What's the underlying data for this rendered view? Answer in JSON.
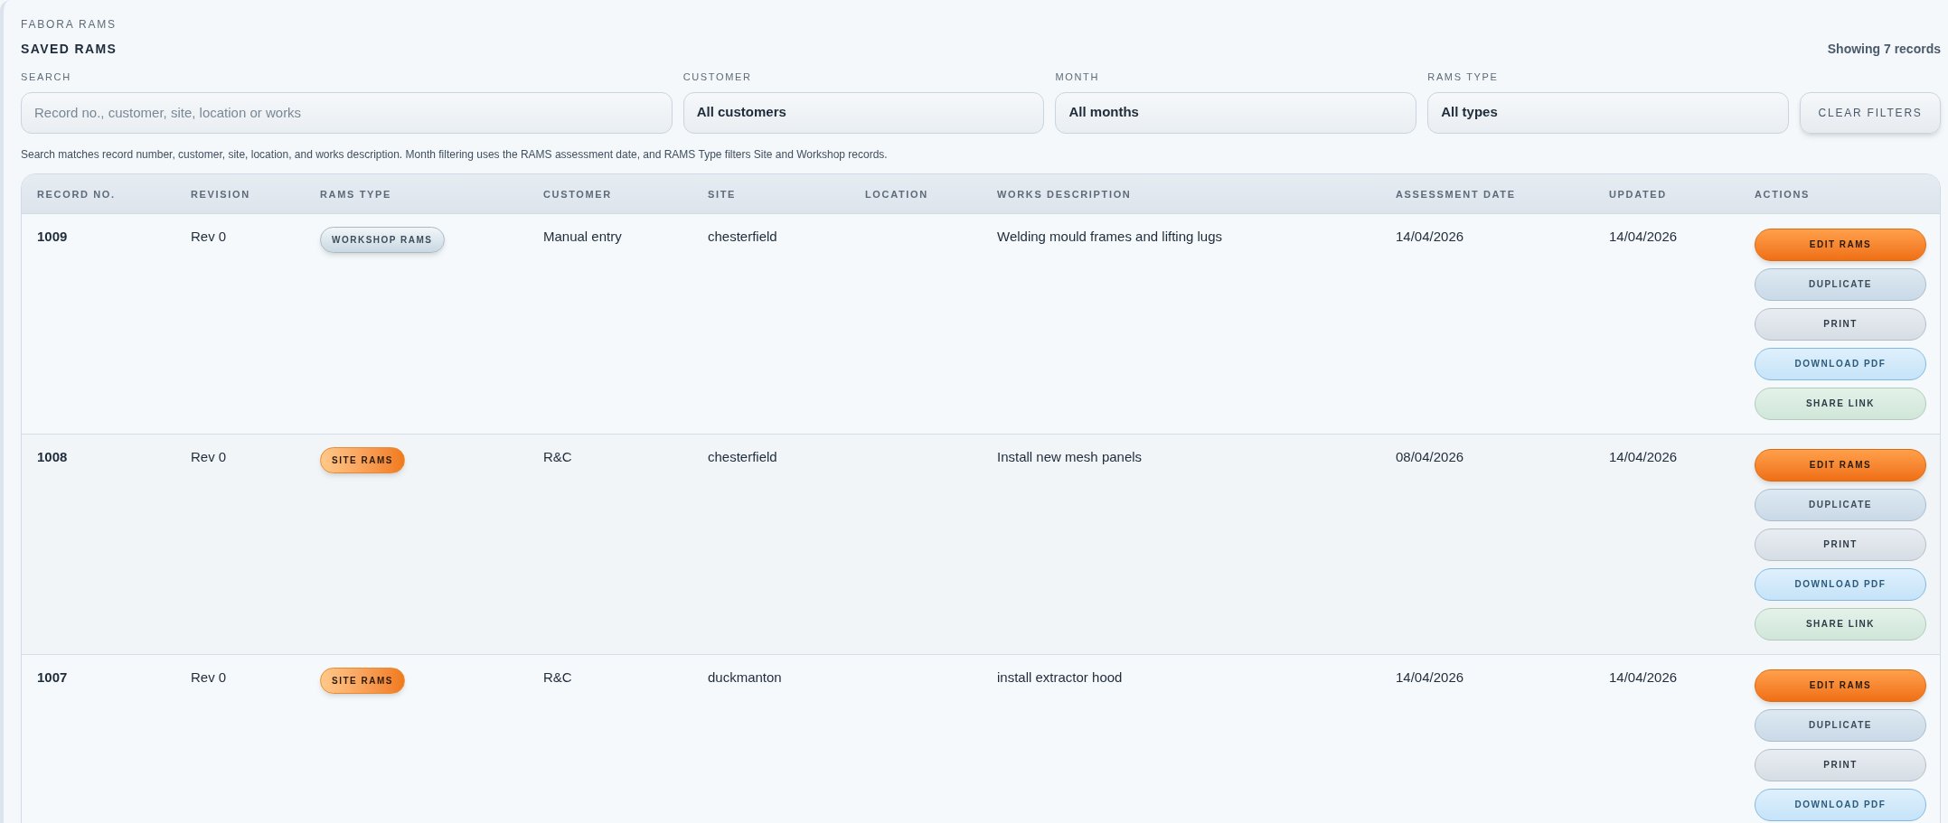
{
  "app": {
    "eyebrow": "FABORA RAMS",
    "title": "SAVED RAMS",
    "record_count": "Showing 7 records"
  },
  "filters": [
    {
      "kind": "search",
      "label": "SEARCH",
      "placeholder": "Record no., customer, site, location or works"
    },
    {
      "kind": "select",
      "label": "CUSTOMER",
      "value": "All customers"
    },
    {
      "kind": "select",
      "label": "MONTH",
      "value": "All months"
    },
    {
      "kind": "select",
      "label": "RAMS TYPE",
      "value": "All types"
    }
  ],
  "clear_button": "CLEAR FILTERS",
  "hint": "Search matches record number, customer, site, location, and works description. Month filtering uses the RAMS assessment date, and RAMS Type filters Site and Workshop records.",
  "table": {
    "columns": [
      "RECORD NO.",
      "REVISION",
      "RAMS TYPE",
      "CUSTOMER",
      "SITE",
      "LOCATION",
      "WORKS DESCRIPTION",
      "ASSESSMENT DATE",
      "UPDATED",
      "ACTIONS"
    ],
    "rows": [
      {
        "record": "1009",
        "revision": "Rev 0",
        "type": {
          "kind": "workshop",
          "label": "WORKSHOP RAMS"
        },
        "customer": "Manual entry",
        "site": "chesterfield",
        "works": "Welding mould frames and lifting lugs",
        "assessment_date": "14/04/2026",
        "updated": "14/04/2026",
        "actions": [
          {
            "kind": "edit",
            "label": "EDIT RAMS"
          },
          {
            "kind": "duplicate",
            "label": "DUPLICATE"
          },
          {
            "kind": "print",
            "label": "PRINT"
          },
          {
            "kind": "download",
            "label": "DOWNLOAD PDF"
          },
          {
            "kind": "share",
            "label": "SHARE LINK"
          }
        ]
      },
      {
        "record": "1008",
        "revision": "Rev 0",
        "type": {
          "kind": "site",
          "label": "SITE RAMS"
        },
        "customer": "R&C",
        "site": "chesterfield",
        "works": "Install new mesh panels",
        "assessment_date": "08/04/2026",
        "updated": "14/04/2026",
        "actions": [
          {
            "kind": "edit",
            "label": "EDIT RAMS"
          },
          {
            "kind": "duplicate",
            "label": "DUPLICATE"
          },
          {
            "kind": "print",
            "label": "PRINT"
          },
          {
            "kind": "download",
            "label": "DOWNLOAD PDF"
          },
          {
            "kind": "share",
            "label": "SHARE LINK"
          }
        ]
      },
      {
        "record": "1007",
        "revision": "Rev 0",
        "type": {
          "kind": "site",
          "label": "SITE RAMS"
        },
        "customer": "R&C",
        "site": "duckmanton",
        "works": "install extractor hood",
        "assessment_date": "14/04/2026",
        "updated": "14/04/2026",
        "actions": [
          {
            "kind": "edit",
            "label": "EDIT RAMS"
          },
          {
            "kind": "duplicate",
            "label": "DUPLICATE"
          },
          {
            "kind": "print",
            "label": "PRINT"
          },
          {
            "kind": "download",
            "label": "DOWNLOAD PDF"
          }
        ]
      }
    ]
  }
}
